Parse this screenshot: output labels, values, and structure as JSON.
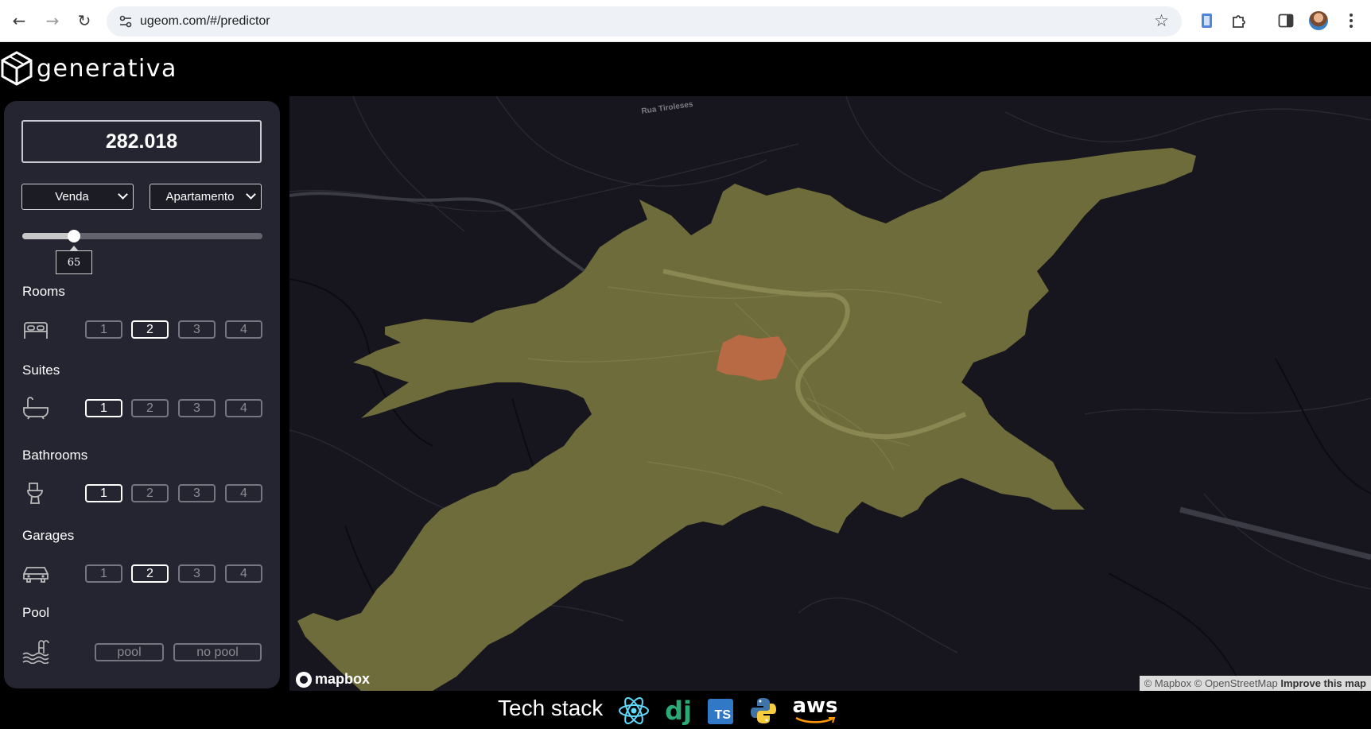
{
  "browser": {
    "url": "ugeom.com/#/predictor"
  },
  "app": {
    "logo_text": "generativa"
  },
  "predictor": {
    "price": "282.018",
    "transaction_type": "Venda",
    "property_type": "Apartamento",
    "area": {
      "value": "65",
      "fraction": 0.215
    },
    "rooms": {
      "label": "Rooms",
      "options": [
        "1",
        "2",
        "3",
        "4"
      ],
      "selected": "2"
    },
    "suites": {
      "label": "Suites",
      "options": [
        "1",
        "2",
        "3",
        "4"
      ],
      "selected": "1"
    },
    "bathrooms": {
      "label": "Bathrooms",
      "options": [
        "1",
        "2",
        "3",
        "4"
      ],
      "selected": "1"
    },
    "garages": {
      "label": "Garages",
      "options": [
        "1",
        "2",
        "3",
        "4"
      ],
      "selected": "2"
    },
    "pool": {
      "label": "Pool",
      "options": [
        "pool",
        "no pool"
      ]
    }
  },
  "map": {
    "street_label": "Rua Tiroleses",
    "mapbox_label": "mapbox",
    "attribution": "© Mapbox © OpenStreetMap",
    "improve_link": "Improve this map",
    "colors": {
      "background": "#17161f",
      "region": "#6e6c3a",
      "highlight": "#b86a45"
    }
  },
  "footer": {
    "tech_stack_label": "Tech stack",
    "icons": [
      "react-icon",
      "django-icon",
      "typescript-icon",
      "python-icon",
      "aws-icon"
    ],
    "ts_text": "TS",
    "dj_text": "dj",
    "aws_text": "aws"
  }
}
